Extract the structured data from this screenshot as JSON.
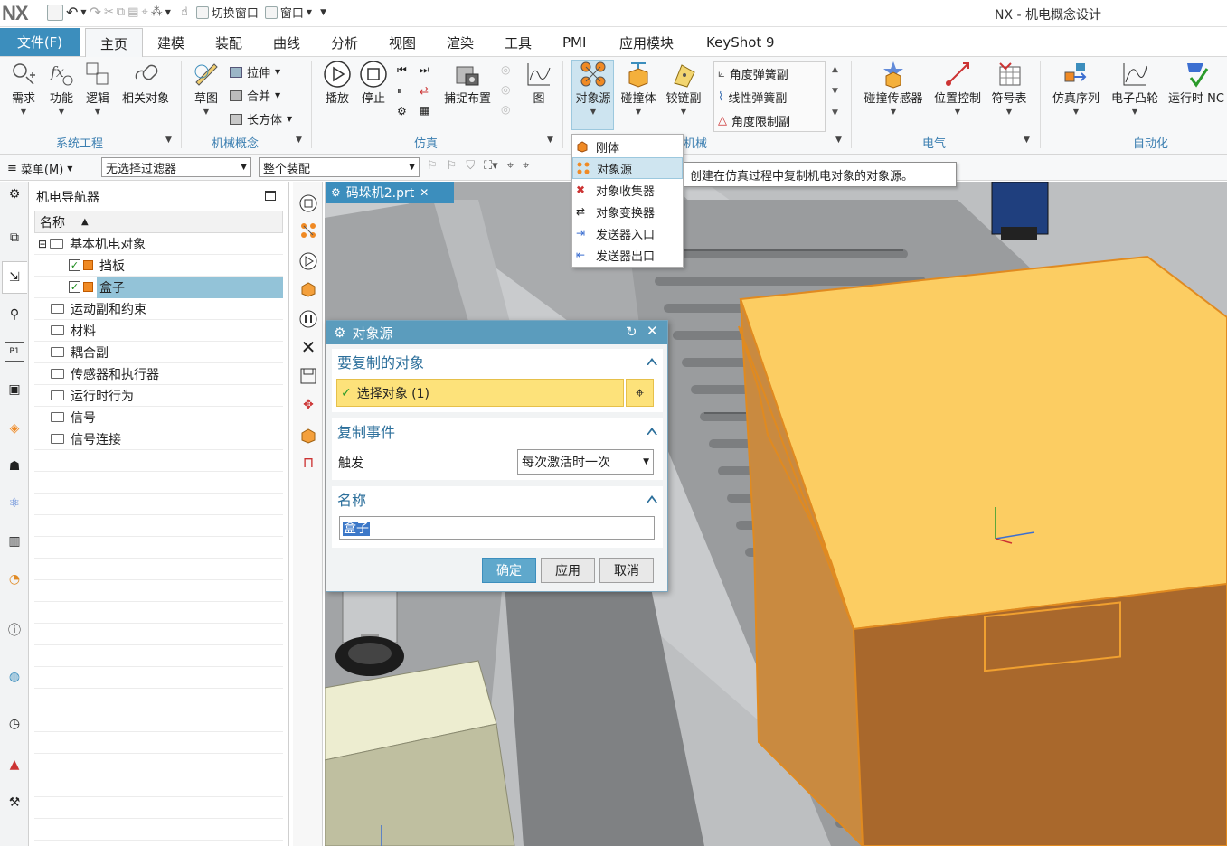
{
  "titlebar": {
    "logo": "NX",
    "switch_window": "切换窗口",
    "window": "窗口",
    "app_title": "NX - 机电概念设计"
  },
  "menu": {
    "file": "文件(F)",
    "tabs": [
      "主页",
      "建模",
      "装配",
      "曲线",
      "分析",
      "视图",
      "渲染",
      "工具",
      "PMI",
      "应用模块",
      "KeyShot 9"
    ],
    "active_tab": "主页"
  },
  "ribbon": {
    "system_engineering": {
      "label": "系统工程",
      "buttons": [
        "需求",
        "功能",
        "逻辑",
        "相关对象"
      ]
    },
    "mechanical_concept": {
      "label": "机械概念",
      "sketch": "草图",
      "small": [
        "拉伸",
        "合并",
        "长方体"
      ]
    },
    "simulation": {
      "label": "仿真",
      "buttons": [
        "播放",
        "停止",
        "捕捉布置",
        "图"
      ]
    },
    "mechanical": {
      "label": "机械",
      "buttons": [
        "对象源",
        "碰撞体",
        "铰链副"
      ],
      "small": [
        "角度弹簧副",
        "线性弹簧副",
        "角度限制副"
      ]
    },
    "electrical": {
      "label": "电气",
      "buttons": [
        "碰撞传感器",
        "位置控制",
        "符号表"
      ]
    },
    "automation": {
      "label": "自动化",
      "buttons": [
        "仿真序列",
        "电子凸轮",
        "运行时 NC"
      ]
    }
  },
  "selection_bar": {
    "menu": "菜单(M)",
    "filter": "无选择过滤器",
    "assembly": "整个装配"
  },
  "navigator": {
    "title": "机电导航器",
    "column": "名称",
    "rows": [
      {
        "label": "基本机电对象",
        "type": "folder",
        "level": 0,
        "expand": "⊟"
      },
      {
        "label": "挡板",
        "type": "object",
        "level": 1,
        "checked": true
      },
      {
        "label": "盒子",
        "type": "object",
        "level": 1,
        "checked": true,
        "selected": true
      },
      {
        "label": "运动副和约束",
        "type": "folder",
        "level": 0
      },
      {
        "label": "材料",
        "type": "folder",
        "level": 0
      },
      {
        "label": "耦合副",
        "type": "folder",
        "level": 0
      },
      {
        "label": "传感器和执行器",
        "type": "folder",
        "level": 0
      },
      {
        "label": "运行时行为",
        "type": "folder",
        "level": 0
      },
      {
        "label": "信号",
        "type": "folder",
        "level": 0
      },
      {
        "label": "信号连接",
        "type": "folder",
        "level": 0
      }
    ]
  },
  "document_tab": "码垛机2.prt",
  "dropdown": {
    "items": [
      "刚体",
      "对象源",
      "对象收集器",
      "对象变换器",
      "发送器入口",
      "发送器出口"
    ],
    "highlighted": "对象源",
    "tooltip": "创建在仿真过程中复制机电对象的对象源。"
  },
  "dialog": {
    "title": "对象源",
    "section_object": "要复制的对象",
    "select_object": "选择对象 (1)",
    "section_event": "复制事件",
    "trigger_label": "触发",
    "trigger_value": "每次激活时一次",
    "section_name": "名称",
    "name_value": "盒子",
    "ok": "确定",
    "apply": "应用",
    "cancel": "取消"
  },
  "colors": {
    "accent": "#3c8ebd",
    "group_label": "#3c7fb1",
    "selection": "#93c3d8",
    "highlight_yellow": "#fde27a",
    "box_top": "#fcc45e",
    "box_side": "#a96a2e"
  }
}
